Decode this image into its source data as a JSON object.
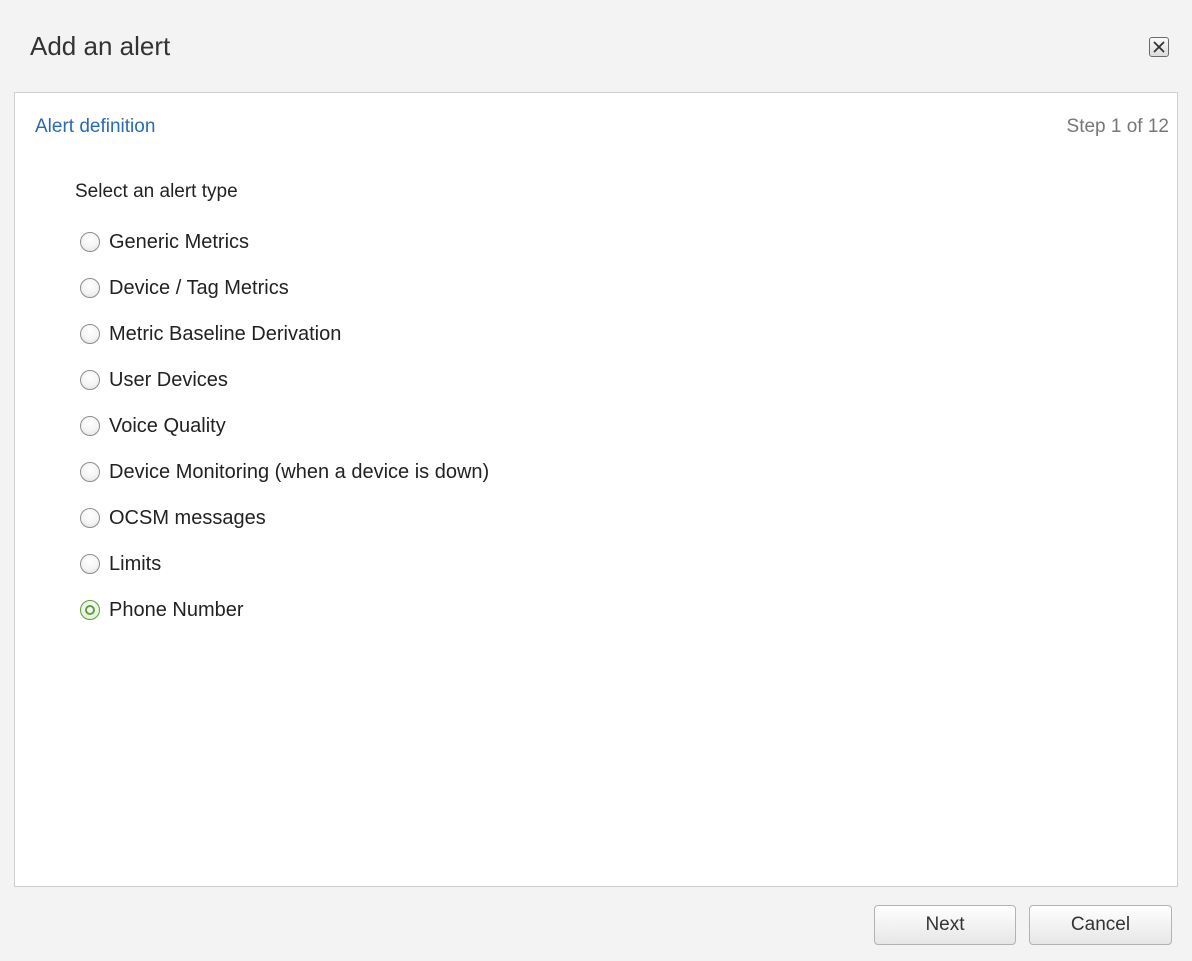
{
  "dialog": {
    "title": "Add an alert",
    "close_icon": "close-icon"
  },
  "content": {
    "section_title": "Alert definition",
    "step_text": "Step 1 of 12",
    "prompt": "Select an alert type",
    "options": [
      {
        "label": "Generic Metrics",
        "checked": false
      },
      {
        "label": "Device / Tag Metrics",
        "checked": false
      },
      {
        "label": "Metric Baseline Derivation",
        "checked": false
      },
      {
        "label": "User Devices",
        "checked": false
      },
      {
        "label": "Voice Quality",
        "checked": false
      },
      {
        "label": "Device Monitoring (when a device is down)",
        "checked": false
      },
      {
        "label": "OCSM messages",
        "checked": false
      },
      {
        "label": "Limits",
        "checked": false
      },
      {
        "label": "Phone Number",
        "checked": true
      }
    ],
    "selected_option": "Phone Number"
  },
  "footer": {
    "next_label": "Next",
    "cancel_label": "Cancel"
  },
  "colors": {
    "link_blue": "#2a6bb0",
    "radio_checked_green": "#5aa13a",
    "dialog_background": "#f3f3f3",
    "panel_background": "#ffffff"
  }
}
